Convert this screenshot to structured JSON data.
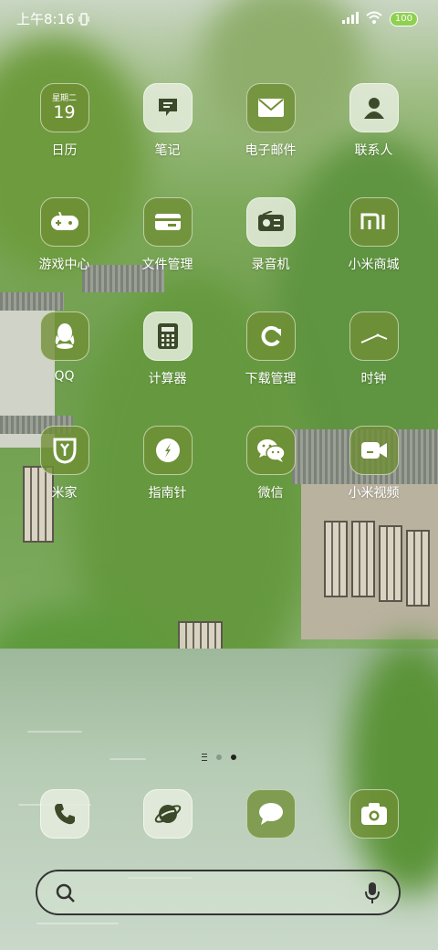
{
  "status": {
    "time": "上午8:16",
    "battery": "100"
  },
  "apps": [
    {
      "label": "日历",
      "icon": "calendar-icon",
      "week": "星期二",
      "day": "19"
    },
    {
      "label": "笔记",
      "icon": "note-icon"
    },
    {
      "label": "电子邮件",
      "icon": "mail-icon"
    },
    {
      "label": "联系人",
      "icon": "contact-icon"
    },
    {
      "label": "游戏中心",
      "icon": "gamepad-icon"
    },
    {
      "label": "文件管理",
      "icon": "folder-icon"
    },
    {
      "label": "录音机",
      "icon": "recorder-icon"
    },
    {
      "label": "小米商城",
      "icon": "mi-store-icon"
    },
    {
      "label": "QQ",
      "icon": "qq-icon"
    },
    {
      "label": "计算器",
      "icon": "calculator-icon"
    },
    {
      "label": "下载管理",
      "icon": "download-icon"
    },
    {
      "label": "时钟",
      "icon": "clock-icon"
    },
    {
      "label": "米家",
      "icon": "mijia-icon"
    },
    {
      "label": "指南针",
      "icon": "compass-icon"
    },
    {
      "label": "微信",
      "icon": "wechat-icon"
    },
    {
      "label": "小米视频",
      "icon": "video-icon"
    }
  ],
  "dock": [
    {
      "icon": "phone-icon"
    },
    {
      "icon": "browser-icon"
    },
    {
      "icon": "message-icon"
    },
    {
      "icon": "camera-icon"
    }
  ],
  "pages": {
    "count": 2,
    "current": 2
  },
  "search": {
    "placeholder": ""
  },
  "colors": {
    "icon_bg": "#6f8e34",
    "icon_light_bg": "#e6edde",
    "label": "#ffffff",
    "battery": "#8ed14f"
  }
}
